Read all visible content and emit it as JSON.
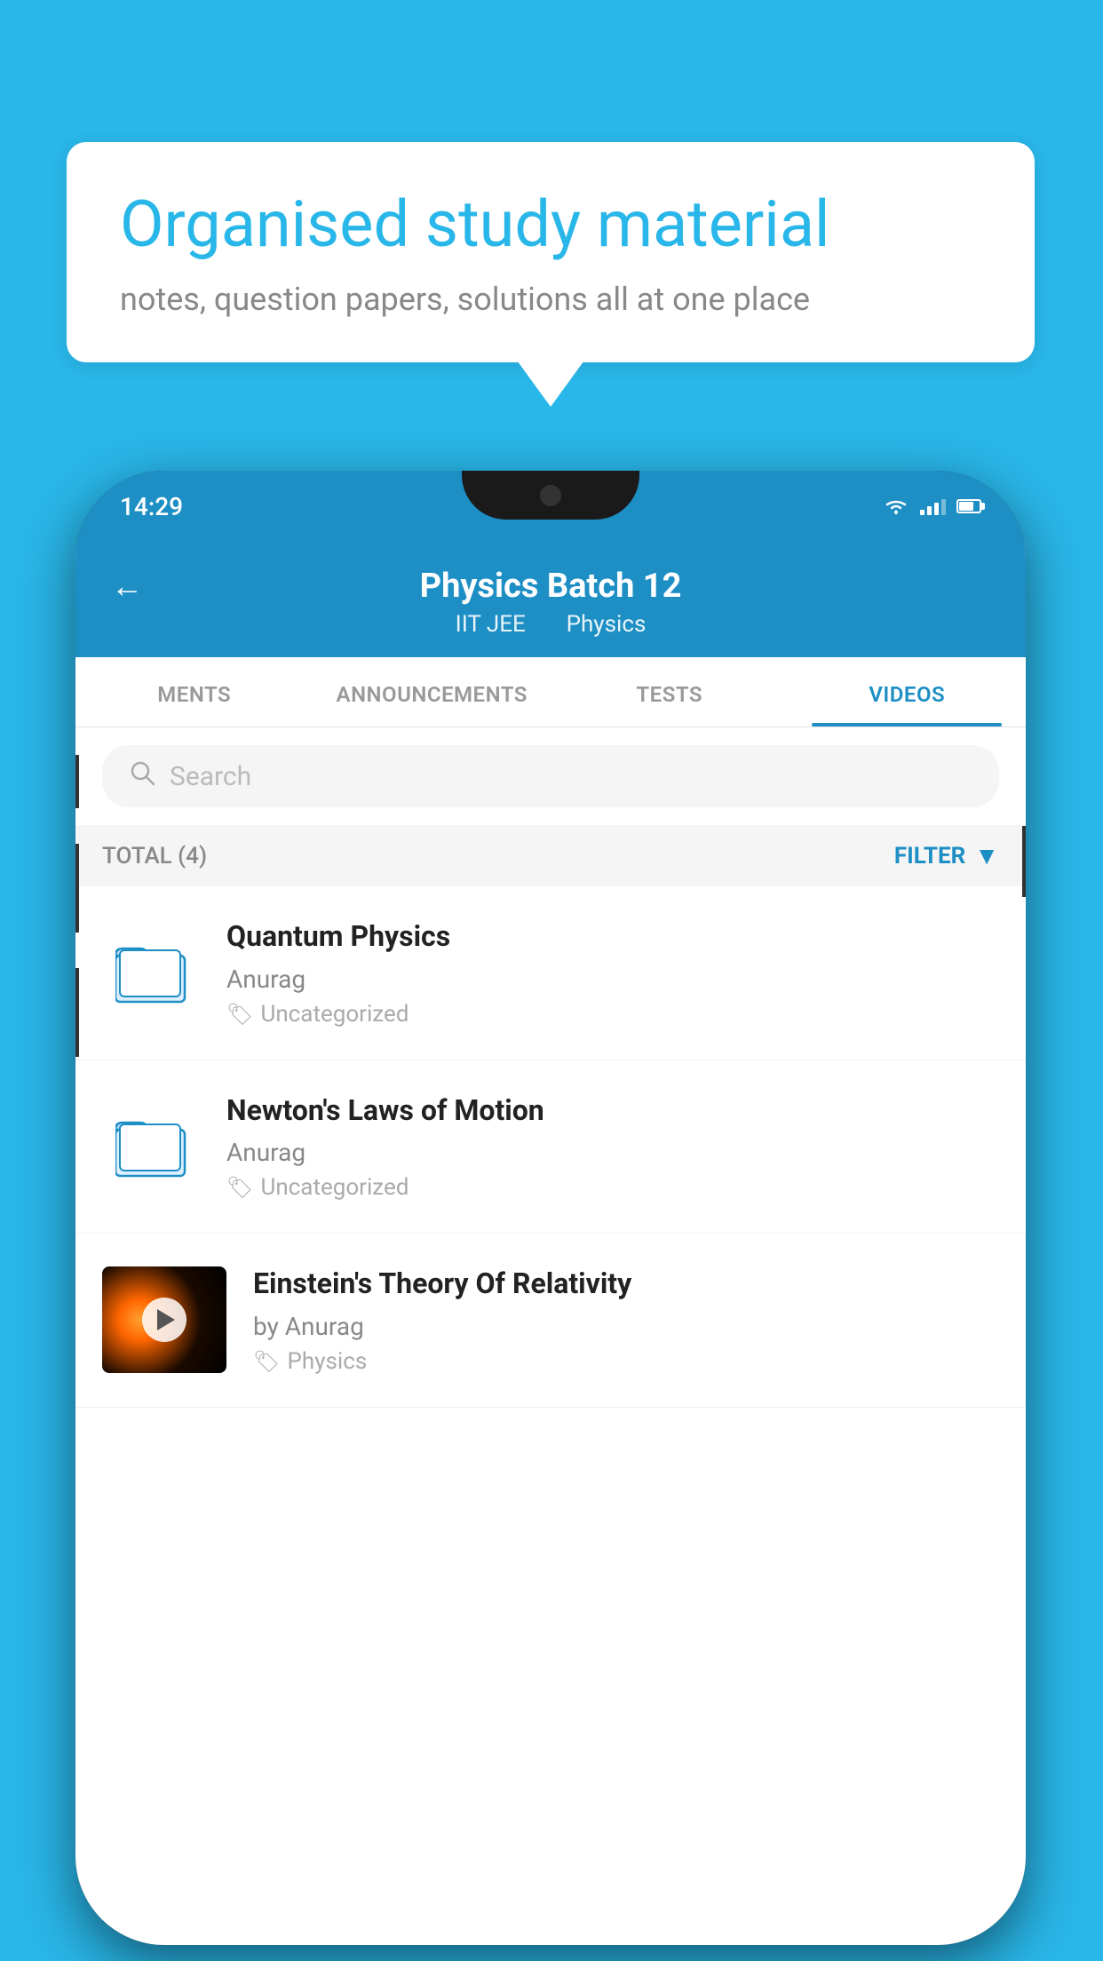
{
  "background": {
    "color": "#29b6e8"
  },
  "bubble": {
    "title": "Organised study material",
    "subtitle": "notes, question papers, solutions all at one place"
  },
  "phone": {
    "status_bar": {
      "time": "14:29"
    },
    "header": {
      "title": "Physics Batch 12",
      "subtitle1": "IIT JEE",
      "subtitle2": "Physics",
      "back_label": "←"
    },
    "tabs": [
      {
        "label": "MENTS",
        "active": false
      },
      {
        "label": "ANNOUNCEMENTS",
        "active": false
      },
      {
        "label": "TESTS",
        "active": false
      },
      {
        "label": "VIDEOS",
        "active": true
      }
    ],
    "search": {
      "placeholder": "Search"
    },
    "filter": {
      "total_label": "TOTAL (4)",
      "filter_label": "FILTER"
    },
    "videos": [
      {
        "id": 1,
        "title": "Quantum Physics",
        "author": "Anurag",
        "tag": "Uncategorized",
        "has_thumb": false
      },
      {
        "id": 2,
        "title": "Newton's Laws of Motion",
        "author": "Anurag",
        "tag": "Uncategorized",
        "has_thumb": false
      },
      {
        "id": 3,
        "title": "Einstein's Theory Of Relativity",
        "author": "by Anurag",
        "tag": "Physics",
        "has_thumb": true
      }
    ]
  }
}
